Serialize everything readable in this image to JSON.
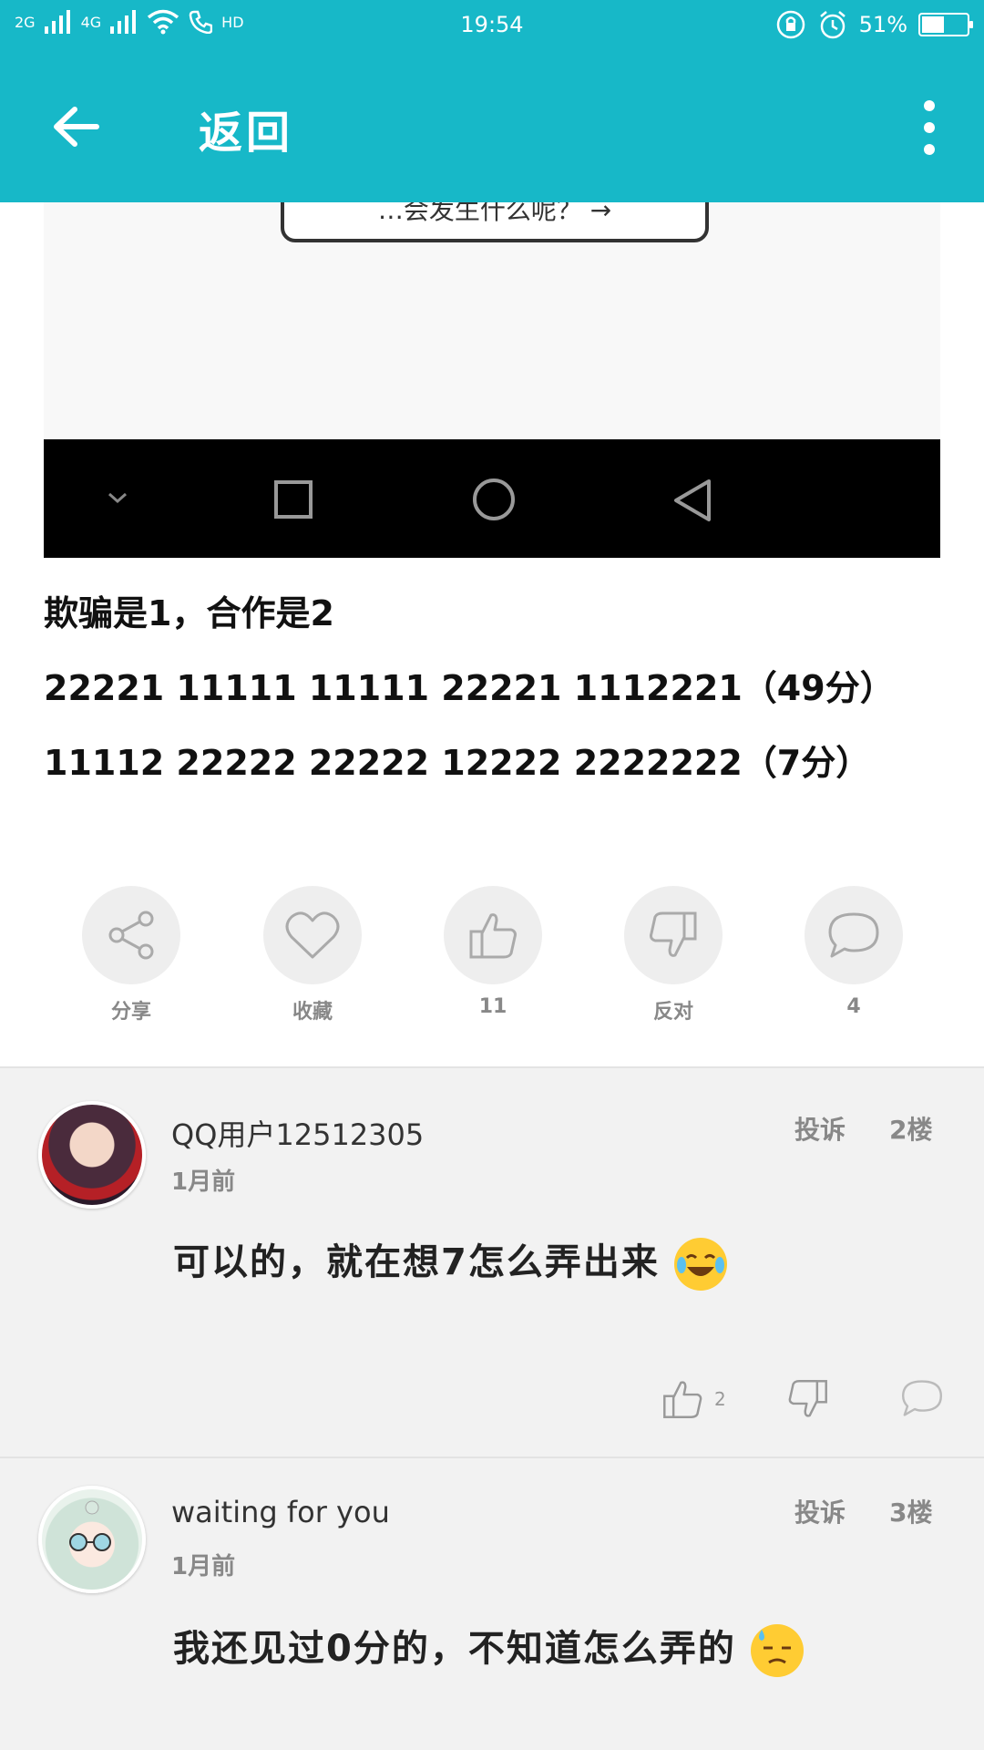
{
  "status_bar": {
    "network_1": "2G",
    "network_2": "4G",
    "call_label": "HD",
    "time": "19:54",
    "battery_text": "51%",
    "battery_level": 0.51,
    "icons": [
      "signal-icon",
      "signal-icon",
      "wifi-icon",
      "phone-icon",
      "rotation-lock-icon",
      "alarm-icon",
      "battery-icon"
    ]
  },
  "app_bar": {
    "title": "返回",
    "icons": [
      "back-arrow-icon",
      "more-vert-icon"
    ]
  },
  "post": {
    "image_bubble_text": "…会发生什么呢？ →",
    "image_nav_icons": [
      "chevron-down-icon",
      "square-icon",
      "circle-icon",
      "triangle-back-icon"
    ],
    "lines": [
      "欺骗是1，合作是2",
      "22221 11111 11111 22221 1112221（49分）",
      "11112 22222 22222 12222 2222222（7分）"
    ]
  },
  "actions": [
    {
      "icon": "share-icon",
      "label": "分享"
    },
    {
      "icon": "heart-icon",
      "label": "收藏"
    },
    {
      "icon": "thumbs-up-icon",
      "label": "11"
    },
    {
      "icon": "thumbs-down-icon",
      "label": "反对"
    },
    {
      "icon": "comment-icon",
      "label": "4"
    }
  ],
  "comments": [
    {
      "username": "QQ用户12512305",
      "time": "1月前",
      "report": "投诉",
      "floor": "2楼",
      "text": "可以的，就在想7怎么弄出来",
      "emoji": "laughing-tears-emoji",
      "like_count": "2"
    },
    {
      "username": "waiting for you",
      "time": "1月前",
      "report": "投诉",
      "floor": "3楼",
      "text": "我还见过0分的，不知道怎么弄的",
      "emoji": "downcast-sweat-emoji"
    }
  ],
  "colors": {
    "accent": "#17b8c8",
    "action_circle": "#eeeeee",
    "comment_bg": "#f2f2f2"
  }
}
